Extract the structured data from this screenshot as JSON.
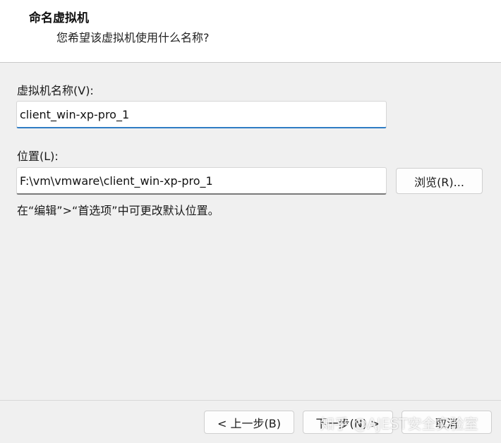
{
  "header": {
    "title": "命名虚拟机",
    "subtitle": "您希望该虚拟机使用什么名称?"
  },
  "name_field": {
    "label": "虚拟机名称(V):",
    "value": "client_win-xp-pro_1"
  },
  "location_field": {
    "label": "位置(L):",
    "value": "F:\\vm\\vmware\\client_win-xp-pro_1",
    "browse_label": "浏览(R)..."
  },
  "hint_text": "在“编辑”>“首选项”中可更改默认位置。",
  "footer": {
    "back_label": "< 上一步(B)",
    "next_label": "下一步(N) >",
    "cancel_label": "取消"
  },
  "watermark": "知乎 @AJEST安全实验室",
  "colors": {
    "focus_accent": "#2f7cc4",
    "dialog_bg": "#f0f0f0",
    "header_bg": "#ffffff"
  }
}
